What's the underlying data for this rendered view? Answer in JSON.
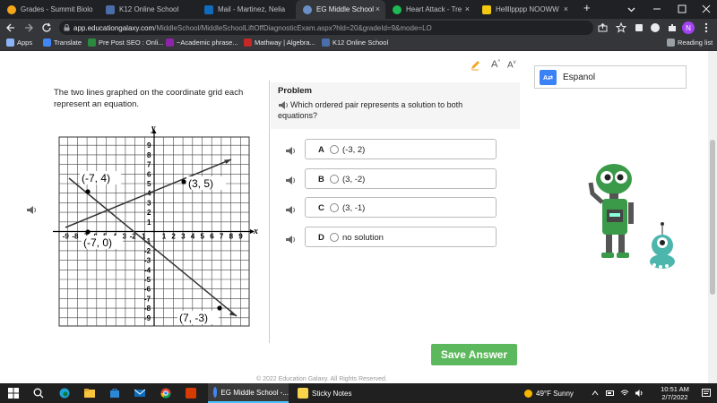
{
  "browser": {
    "tabs": [
      {
        "label": "Grades - Summit Biolo",
        "color": "#f4a61c"
      },
      {
        "label": "K12 Online School",
        "color": "#4a6ea9"
      },
      {
        "label": "Mail - Martinez, Nelia",
        "color": "#0f6cbd"
      },
      {
        "label": "EG Middle School",
        "color": "#6a8fc7"
      },
      {
        "label": "Heart Attack - Tre",
        "color": "#1db954"
      },
      {
        "label": "Hellllpppp NOOWW",
        "color": "#f2c811"
      }
    ],
    "new_tab": "+",
    "close_glyph": "×",
    "url_host": "app.educationgalaxy.com",
    "url_path": "/MiddleSchool/MiddleSchoolLiftOffDiagnosticExam.aspx?hld=20&gradeId=9&mode=LO",
    "profile_initial": "N",
    "bookmarks": [
      {
        "label": "Apps",
        "color": "#8ab4f8"
      },
      {
        "label": "Translate",
        "color": "#4285f4"
      },
      {
        "label": "Pre Post SEO : Onli...",
        "color": "#2b8a3e"
      },
      {
        "label": "~Academic phrase...",
        "color": "#8e24aa"
      },
      {
        "label": "Mathway | Algebra...",
        "color": "#c62828"
      },
      {
        "label": "K12 Online School",
        "color": "#4a6ea9"
      }
    ],
    "reading_list": "Reading list"
  },
  "page": {
    "question": "The two lines graphed on the coordinate grid each represent an equation.",
    "problem_title": "Problem",
    "problem_question": "Which ordered pair represents a solution to both equations?",
    "answers": [
      {
        "letter": "A",
        "value": "(-3, 2)"
      },
      {
        "letter": "B",
        "value": "(3, -2)"
      },
      {
        "letter": "C",
        "value": "(3, -1)"
      },
      {
        "letter": "D",
        "value": "no solution"
      }
    ],
    "save_label": "Save Answer",
    "espanol_label": "Espanol",
    "text_size_label": "A",
    "footer": "© 2022 Education Galaxy. All Rights Reserved."
  },
  "graph": {
    "x_label": "x",
    "y_label": "y",
    "x_ticks": [
      "-9",
      "-8",
      "-7",
      "-6",
      "-5",
      "-4",
      "-3",
      "-2",
      "-1",
      "1",
      "2",
      "3",
      "4",
      "5",
      "6",
      "7",
      "8",
      "9"
    ],
    "y_ticks": [
      "9",
      "8",
      "7",
      "6",
      "5",
      "4",
      "3",
      "2",
      "1",
      "-1",
      "-2",
      "-3",
      "-4",
      "-5",
      "-6",
      "-7",
      "-8",
      "-9"
    ],
    "points": [
      {
        "label": "(-7, 4)"
      },
      {
        "label": "(3, 5)"
      },
      {
        "label": "(-7, 0)"
      },
      {
        "label": "(7, -3)"
      }
    ]
  },
  "taskbar": {
    "apps": [
      {
        "label": "EG Middle School -...",
        "color": "#4285f4"
      },
      {
        "label": "Sticky Notes",
        "color": "#f7d44c"
      }
    ],
    "weather": "49°F  Sunny",
    "time": "10:51 AM",
    "date": "2/7/2022"
  }
}
